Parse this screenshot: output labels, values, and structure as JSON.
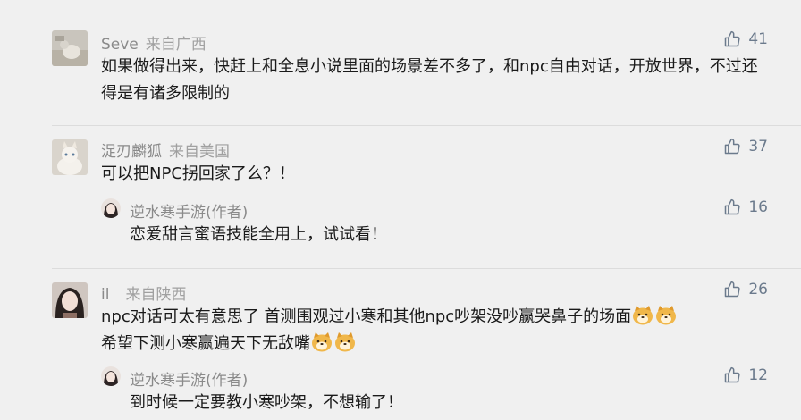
{
  "comments": [
    {
      "user": "Seve",
      "location": "来自广西",
      "likes": "41",
      "text": "如果做得出来，快赶上和全息小说里面的场景差不多了，和npc自由对话，开放世界，不过还得是有诸多限制的"
    },
    {
      "user": "浞刃麟狐",
      "location": "来自美国",
      "likes": "37",
      "text": "可以把NPC拐回家了么？！",
      "reply": {
        "user": "逆水寒手游(作者)",
        "likes": "16",
        "text": "恋爱甜言蜜语技能全用上，试试看！"
      }
    },
    {
      "user": "il",
      "location": "来自陕西",
      "likes": "26",
      "text_line1": "npc对话可太有意思了 首测围观过小寒和其他npc吵架没吵赢哭鼻子的场面",
      "text_line2": "希望下测小寒赢遍天下无敌嘴",
      "reply": {
        "user": "逆水寒手游(作者)",
        "likes": "12",
        "text": "到时候一定要教小寒吵架，不想输了！"
      }
    }
  ],
  "icons": {
    "like": "thumbs-up-icon",
    "emoji": "doge-emoji-icon"
  },
  "colors": {
    "background": "#f0f0f0",
    "username": "#8a8a8a",
    "text": "#1a1a1a",
    "like": "#6b7a8c"
  }
}
